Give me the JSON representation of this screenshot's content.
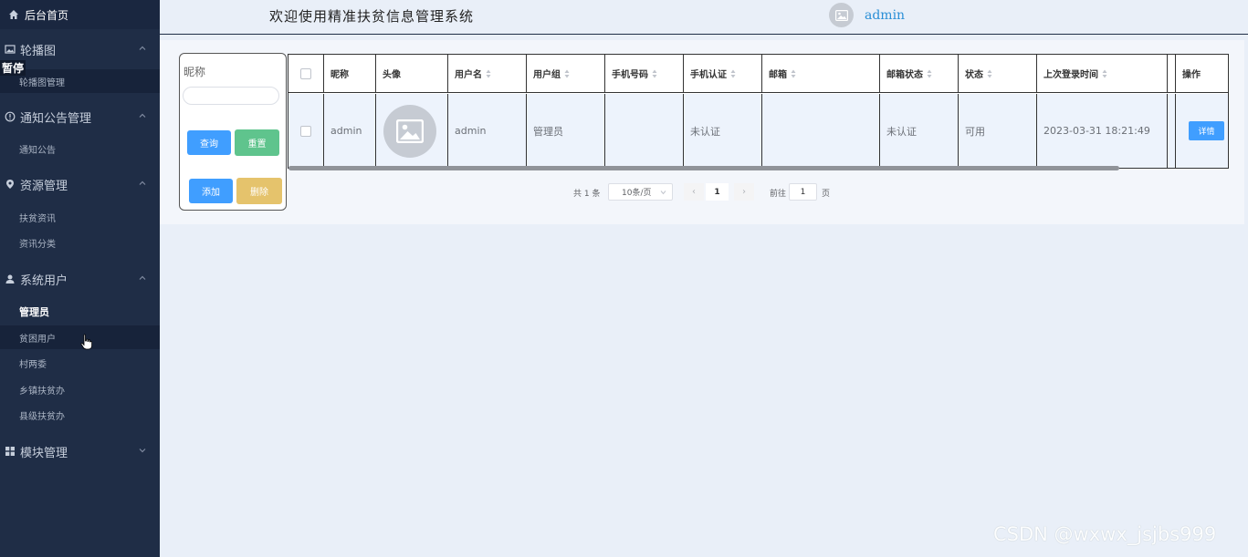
{
  "sidebar": {
    "home": "后台首页",
    "groups": [
      {
        "label": "轮播图",
        "items": [
          "轮播图管理"
        ]
      },
      {
        "label": "通知公告管理",
        "items": [
          "通知公告"
        ]
      },
      {
        "label": "资源管理",
        "items": [
          "扶贫资讯",
          "资讯分类"
        ]
      },
      {
        "label": "系统用户",
        "items": [
          "管理员",
          "贫困用户",
          "村两委",
          "乡镇扶贫办",
          "县级扶贫办"
        ]
      },
      {
        "label": "模块管理",
        "items": []
      }
    ],
    "floating_label": "暂停"
  },
  "header": {
    "welcome": "欢迎使用精准扶贫信息管理系统",
    "username": "admin"
  },
  "search": {
    "label": "昵称",
    "input_value": "",
    "query_label": "查询",
    "reset_label": "重置",
    "add_label": "添加",
    "delete_label": "删除"
  },
  "table": {
    "columns": [
      "昵称",
      "头像",
      "用户名",
      "用户组",
      "手机号码",
      "手机认证",
      "邮箱",
      "邮箱状态",
      "状态",
      "上次登录时间",
      "操作"
    ],
    "rows": [
      {
        "nickname": "admin",
        "username": "admin",
        "group": "管理员",
        "phone": "",
        "phone_verified": "未认证",
        "email": "",
        "email_status": "未认证",
        "status": "可用",
        "last_login": "2023-03-31 18:21:49",
        "action": "详情"
      }
    ]
  },
  "pagination": {
    "total": "共 1 条",
    "page_size": "10条/页",
    "prev": "‹",
    "current": "1",
    "next": "›",
    "goto_prefix": "前往",
    "goto_value": "1",
    "goto_suffix": "页"
  },
  "watermark": "CSDN @wxwx_jsjbs999",
  "colors": {
    "sidebar_bg": "#1f2d46",
    "accent_blue": "#409eff",
    "accent_green": "#5fc48d",
    "accent_yellow": "#e5c36c",
    "username_blue": "#2a8fd6"
  }
}
